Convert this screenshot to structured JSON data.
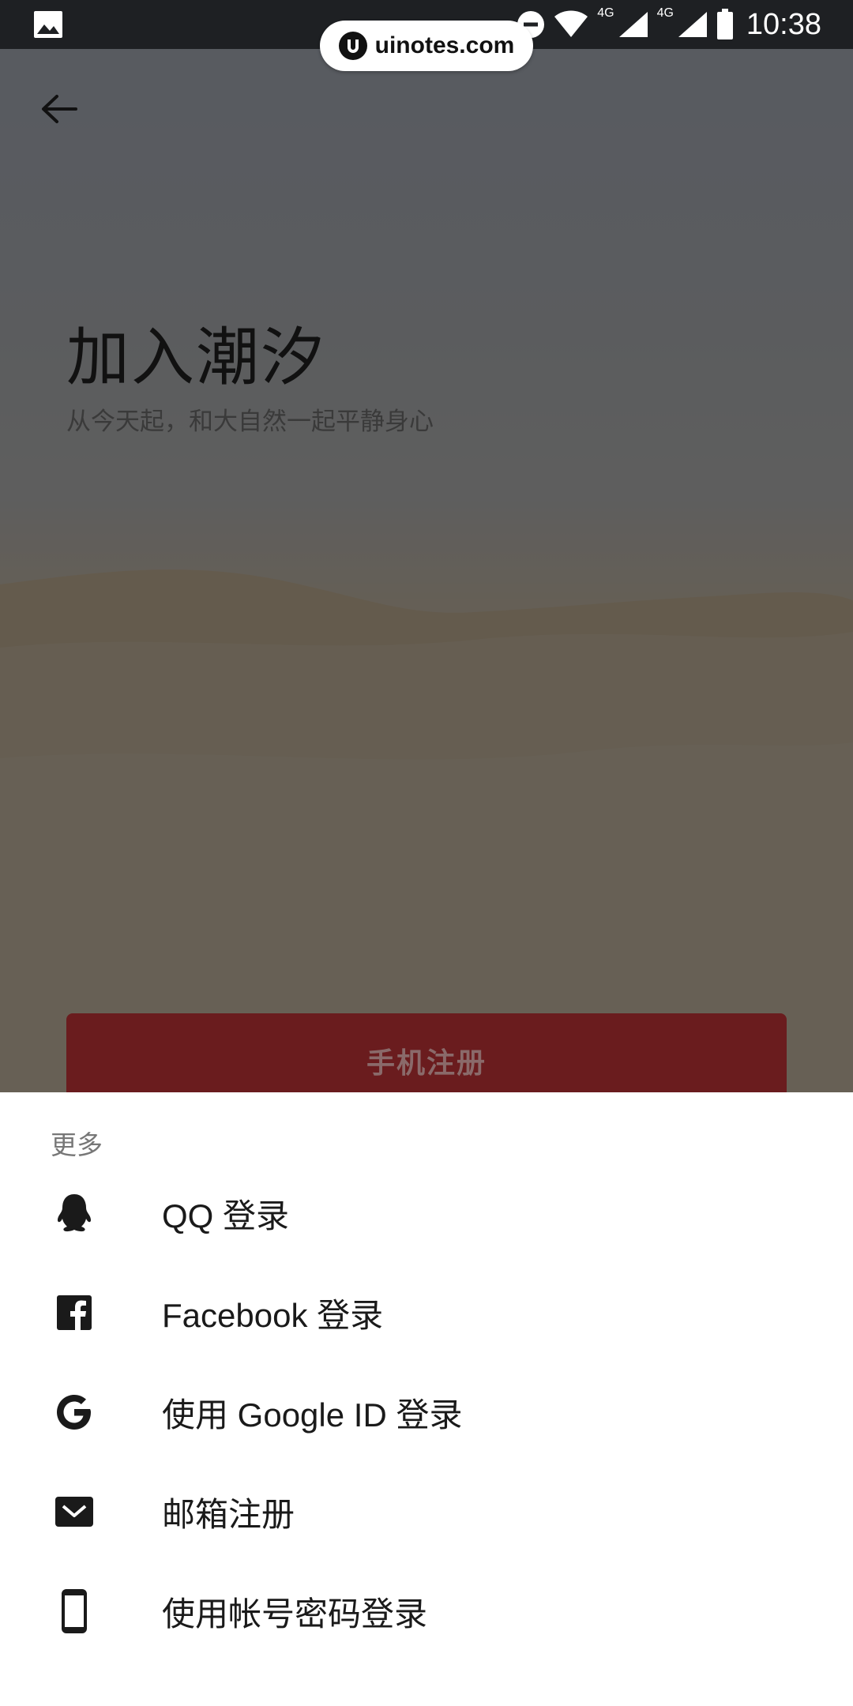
{
  "status_bar": {
    "time": "10:38",
    "network_1": "4G",
    "network_2": "4G",
    "icons": [
      "image-icon",
      "dnd-icon",
      "wifi-icon",
      "signal-icon",
      "signal-icon",
      "battery-icon"
    ]
  },
  "watermark": {
    "text": "uinotes.com"
  },
  "header": {
    "title": "加入潮汐",
    "subtitle": "从今天起，和大自然一起平静身心"
  },
  "primary_button": {
    "label": "手机注册"
  },
  "sheet": {
    "title": "更多",
    "options": [
      {
        "label": "QQ 登录",
        "icon": "qq-icon"
      },
      {
        "label": "Facebook 登录",
        "icon": "facebook-icon"
      },
      {
        "label": "使用 Google ID 登录",
        "icon": "google-icon"
      },
      {
        "label": "邮箱注册",
        "icon": "mail-icon"
      },
      {
        "label": "使用帐号密码登录",
        "icon": "phone-icon"
      }
    ]
  },
  "colors": {
    "primary_button_bg": "#6a1c1e",
    "sheet_bg": "#ffffff",
    "status_bar_bg": "#1e2023"
  }
}
